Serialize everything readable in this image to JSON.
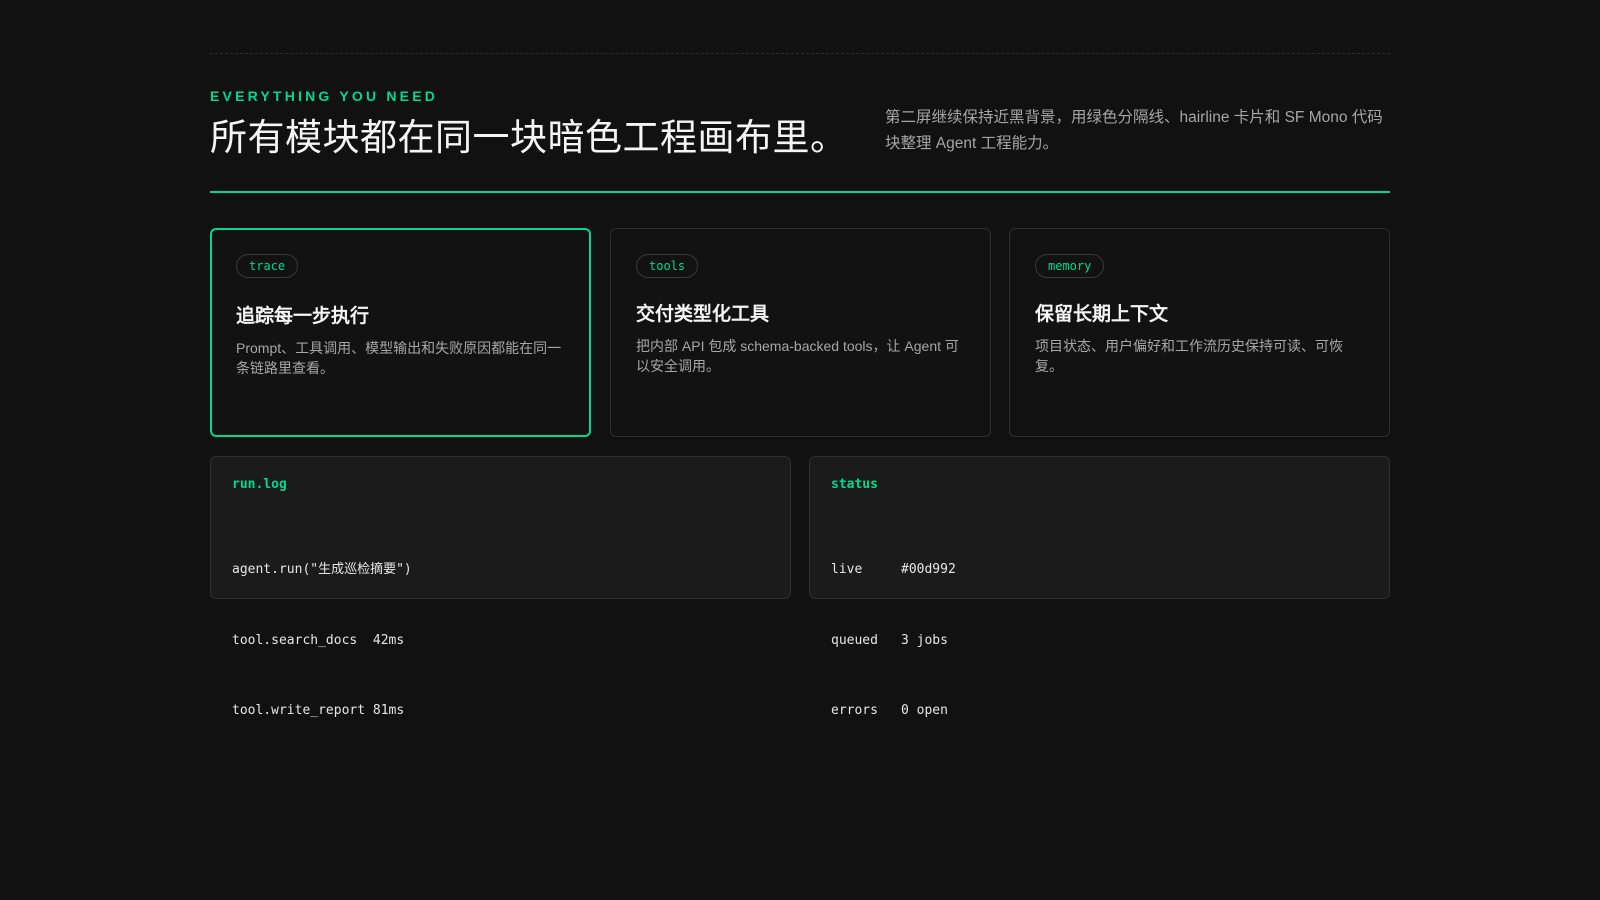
{
  "section": {
    "eyebrow": "EVERYTHING YOU NEED",
    "headline": "所有模块都在同一块暗色工程画布里。",
    "intro": "第二屏继续保持近黑背景，用绿色分隔线、hairline 卡片和 SF Mono 代码块整理 Agent 工程能力。"
  },
  "cards": [
    {
      "tag": "trace",
      "title": "追踪每一步执行",
      "description": "Prompt、工具调用、模型输出和失败原因都能在同一条链路里查看。",
      "active": true
    },
    {
      "tag": "tools",
      "title": "交付类型化工具",
      "description": "把内部 API 包成 schema-backed tools，让 Agent 可以安全调用。",
      "active": false
    },
    {
      "tag": "memory",
      "title": "保留长期上下文",
      "description": "项目状态、用户偏好和工作流历史保持可读、可恢复。",
      "active": false
    }
  ],
  "runlog": {
    "title": "run.log",
    "lines": [
      "agent.run(\"生成巡检摘要\")",
      "tool.search_docs  42ms",
      "tool.write_report 81ms"
    ]
  },
  "status": {
    "title": "status",
    "rows": [
      {
        "key": "live",
        "value": "#00d992"
      },
      {
        "key": "queued",
        "value": "3 jobs"
      },
      {
        "key": "errors",
        "value": "0 open"
      }
    ]
  },
  "colors": {
    "background": "#111111",
    "accent": "#00d992",
    "panel": "#1b1b1b",
    "hairline": "#2e2e2e"
  }
}
